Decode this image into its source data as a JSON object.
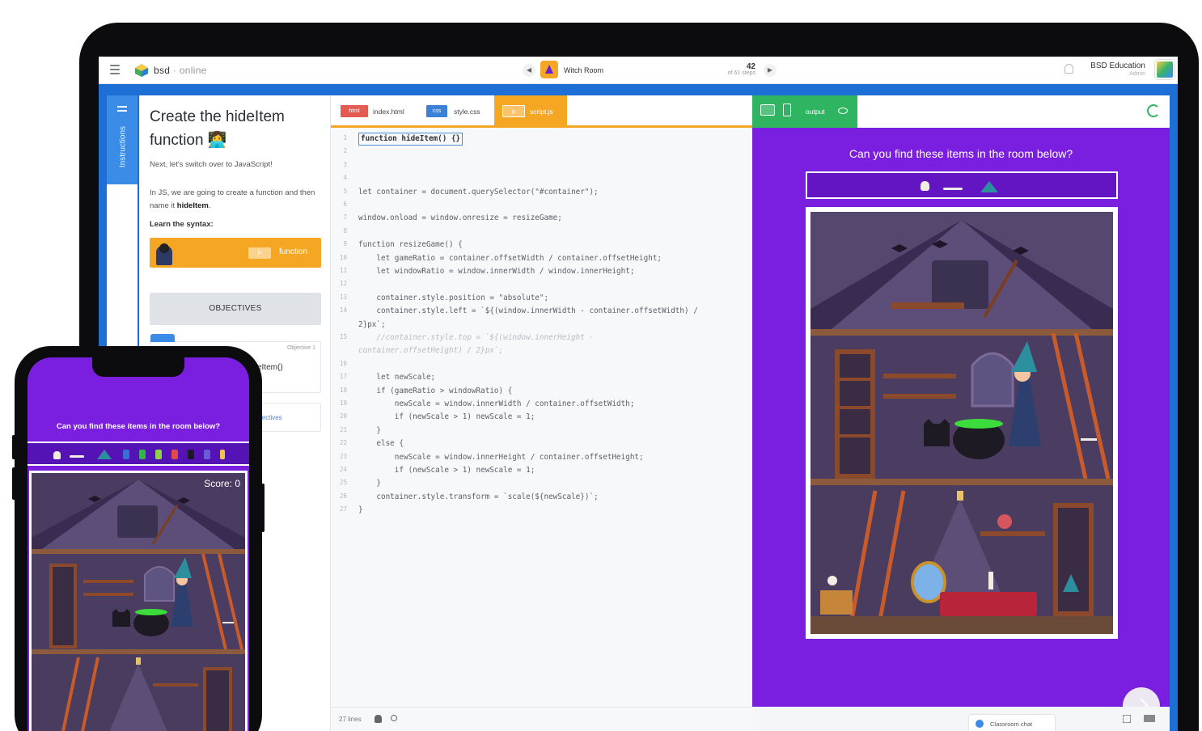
{
  "app": {
    "brand": "bsd",
    "brand_suffix": "online",
    "room_title": "Witch Room",
    "steps_current": "42",
    "steps_total_label": "of 61 steps",
    "org_name": "BSD Education",
    "org_role": "Admin"
  },
  "instructions": {
    "tab_label": "Instructions",
    "title": "Create the hideItem function 👩‍💻",
    "p1": "Next, let's switch over to JavaScript!",
    "p2_pre": "In JS, we are going to create a function and then name it ",
    "p2_bold": "hideItem",
    "p2_post": ".",
    "p3": "Learn the syntax:",
    "syntax_badge": "js",
    "syntax_label": "function",
    "objectives_button": "OBJECTIVES",
    "objective_label": "Objective 1",
    "objective_code": "eItem()",
    "objectives_link": "jectives"
  },
  "editor": {
    "tabs": [
      {
        "chip": "html",
        "name": "index.html"
      },
      {
        "chip": "css",
        "name": "style.css"
      },
      {
        "chip": "js",
        "name": "script.js"
      }
    ],
    "footer_lines": "27 lines",
    "code_lines": [
      {
        "n": "1",
        "t": "function hideItem() {}"
      },
      {
        "n": "2",
        "t": ""
      },
      {
        "n": "3",
        "t": ""
      },
      {
        "n": "4",
        "t": ""
      },
      {
        "n": "5",
        "t": "let container = document.querySelector(\"#container\");"
      },
      {
        "n": "6",
        "t": ""
      },
      {
        "n": "7",
        "t": "window.onload = window.onresize = resizeGame;"
      },
      {
        "n": "8",
        "t": ""
      },
      {
        "n": "9",
        "t": "function resizeGame() {"
      },
      {
        "n": "10",
        "t": "    let gameRatio = container.offsetWidth / container.offsetHeight;"
      },
      {
        "n": "11",
        "t": "    let windowRatio = window.innerWidth / window.innerHeight;"
      },
      {
        "n": "12",
        "t": ""
      },
      {
        "n": "13",
        "t": "    container.style.position = \"absolute\";"
      },
      {
        "n": "14",
        "t": "    container.style.left = `${(window.innerWidth - container.offsetWidth) /"
      },
      {
        "n": "",
        "t": "2}px`;"
      },
      {
        "n": "15",
        "t": "    //container.style.top = `${(window.innerHeight -"
      },
      {
        "n": "",
        "t": "container.offsetHeight) / 2}px`;"
      },
      {
        "n": "16",
        "t": ""
      },
      {
        "n": "17",
        "t": "    let newScale;"
      },
      {
        "n": "18",
        "t": "    if (gameRatio > windowRatio) {"
      },
      {
        "n": "19",
        "t": "        newScale = window.innerWidth / container.offsetWidth;"
      },
      {
        "n": "20",
        "t": "        if (newScale > 1) newScale = 1;"
      },
      {
        "n": "21",
        "t": "    }"
      },
      {
        "n": "22",
        "t": "    else {"
      },
      {
        "n": "23",
        "t": "        newScale = window.innerHeight / container.offsetHeight;"
      },
      {
        "n": "24",
        "t": "        if (newScale > 1) newScale = 1;"
      },
      {
        "n": "25",
        "t": "    }"
      },
      {
        "n": "26",
        "t": "    container.style.transform = `scale(${newScale})`;"
      },
      {
        "n": "27",
        "t": "}"
      }
    ]
  },
  "output": {
    "tab_label": "output",
    "question": "Can you find these items in the room below?",
    "chat_label": "Classroom chat"
  },
  "phone": {
    "question": "Can you find these items in the room below?",
    "score": "Score: 0"
  },
  "colors": {
    "accent_blue": "#3a8ce6",
    "js_orange": "#f5a623",
    "output_green": "#2fb561",
    "game_purple": "#7a1fe0"
  }
}
